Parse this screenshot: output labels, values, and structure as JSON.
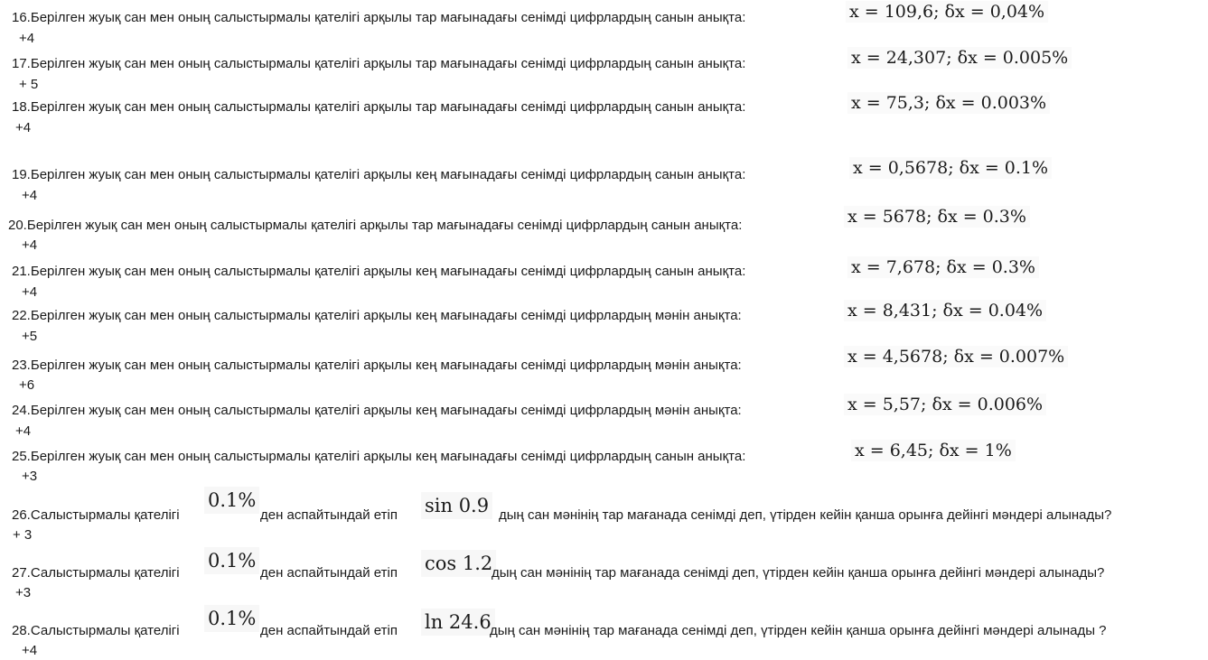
{
  "items": [
    {
      "text": "16.Берілген жуық сан мен оның салыстырмалы қателігі арқылы тар мағынадағы сенімді цифрлардың санын анықта:",
      "formula": "x = 109,6; δx = 0,04%",
      "answer": "+4"
    },
    {
      "text": "17.Берілген жуық сан мен оның салыстырмалы қателігі арқылы тар мағынадағы сенімді цифрлардың санын анықта:",
      "formula": "x = 24,307; δx = 0.005%",
      "answer": "+ 5"
    },
    {
      "text": "18.Берілген жуық сан мен оның салыстырмалы қателігі арқылы тар мағынадағы сенімді цифрлардың санын анықта:",
      "formula": "x = 75,3; δx = 0.003%",
      "answer": "+4"
    },
    {
      "text": "19.Берілген жуық сан мен оның салыстырмалы қателігі арқылы кең мағынадағы сенімді цифрлардың санын анықта:",
      "formula": "x = 0,5678; δx = 0.1%",
      "answer": "+4"
    },
    {
      "text": "20.Берілген жуық сан мен оның салыстырмалы қателігі арқылы тар мағынадағы сенімді цифрлардың санын анықта:",
      "formula": "x = 5678; δx = 0.3%",
      "answer": "+4"
    },
    {
      "text": "21.Берілген жуық сан мен оның салыстырмалы қателігі арқылы кең мағынадағы сенімді цифрлардың санын анықта:",
      "formula": "x = 7,678; δx = 0.3%",
      "answer": "+4"
    },
    {
      "text": "22.Берілген жуық сан мен оның салыстырмалы қателігі арқылы кең мағынадағы сенімді цифрлардың мәнін анықта:",
      "formula": "x = 8,431; δx = 0.04%",
      "answer": "+5"
    },
    {
      "text": "23.Берілген жуық сан мен оның салыстырмалы қателігі арқылы кең мағынадағы сенімді цифрлардың мәнін анықта:",
      "formula": "x = 4,5678; δx = 0.007%",
      "answer": "+6"
    },
    {
      "text": "24.Берілген жуық сан мен оның салыстырмалы қателігі арқылы кең мағынадағы сенімді цифрлардың мәнін анықта:",
      "formula": "x = 5,57; δx = 0.006%",
      "answer": "+4"
    },
    {
      "text": "25.Берілген жуық сан мен оның салыстырмалы қателігі арқылы кең мағынадағы сенімді цифрлардың санын анықта:",
      "formula": "x = 6,45; δx = 1%",
      "answer": "+3"
    }
  ],
  "tail": [
    {
      "prefix": "26.Салыстырмалы қателігі",
      "error": "0.1%",
      "middle": "ден аспайтындай етіп",
      "func": "sin 0.9",
      "suffix": "дың сан мәнінің тар мағанада сенімді деп, үтірден кейін қанша орынға дейінгі мәндері алынады?",
      "answer": "+ 3"
    },
    {
      "prefix": "27.Салыстырмалы қателігі",
      "error": "0.1%",
      "middle": "ден аспайтындай етіп",
      "func": "cos 1.2",
      "suffix": "дың сан мәнінің тар мағанада сенімді деп, үтірден кейін қанша орынға дейінгі мәндері алынады?",
      "answer": "+3"
    },
    {
      "prefix": "28.Салыстырмалы қателігі",
      "error": "0.1%",
      "middle": "ден аспайтындай етіп",
      "func": "ln 24.6",
      "suffix": "дың сан мәнінің тар мағанада сенімді деп, үтірден кейін қанша орынға дейінгі мәндері алынады ?",
      "answer": "+4"
    }
  ]
}
